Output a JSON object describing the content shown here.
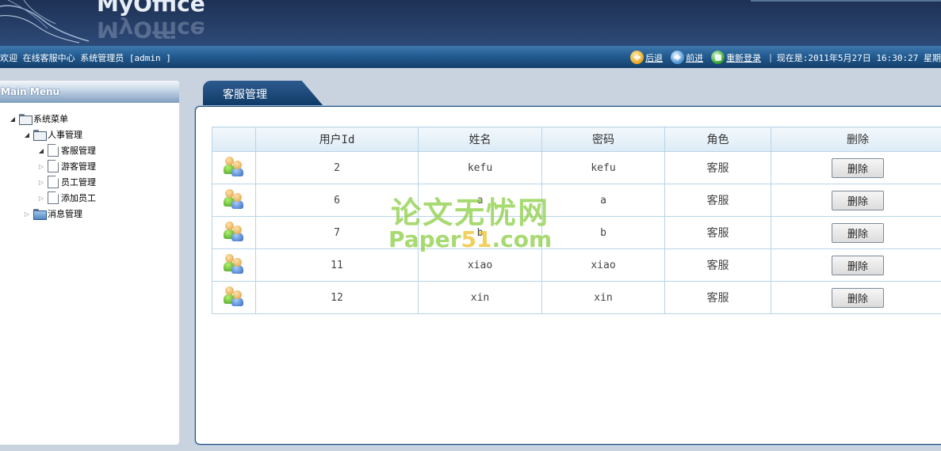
{
  "app": {
    "logo_text": "MyOffice"
  },
  "topbar": {
    "welcome": "欢迎 在线客服中心 系统管理员 [admin ]",
    "back_label": "后退",
    "forward_label": "前进",
    "relogin_label": "重新登录",
    "separator": "|",
    "datetime": "现在是:2011年5月27日 16:30:27 星期"
  },
  "sidebar": {
    "title": "Main Menu",
    "tree": {
      "root": "系统菜单",
      "hr_group": "人事管理",
      "items": [
        "客服管理",
        "游客管理",
        "员工管理",
        "添加员工"
      ],
      "msg_group": "消息管理"
    }
  },
  "main": {
    "tab_label": "客服管理",
    "columns": [
      "",
      "用户Id",
      "姓名",
      "密码",
      "角色",
      "删除"
    ],
    "rows": [
      {
        "id": "2",
        "name": "kefu",
        "password": "kefu",
        "role": "客服",
        "action": "删除"
      },
      {
        "id": "6",
        "name": "a",
        "password": "a",
        "role": "客服",
        "action": "删除"
      },
      {
        "id": "7",
        "name": "b",
        "password": "b",
        "role": "客服",
        "action": "删除"
      },
      {
        "id": "11",
        "name": "xiao",
        "password": "xiao",
        "role": "客服",
        "action": "删除"
      },
      {
        "id": "12",
        "name": "xin",
        "password": "xin",
        "role": "客服",
        "action": "删除"
      }
    ]
  },
  "watermark": {
    "cn": "论文无忧网",
    "en_pre": "Paper",
    "en_mid": "51",
    "en_post": ".com"
  },
  "colors": {
    "header": "#1d3154",
    "accent": "#235c92",
    "grid_border": "#b9d4e8"
  }
}
